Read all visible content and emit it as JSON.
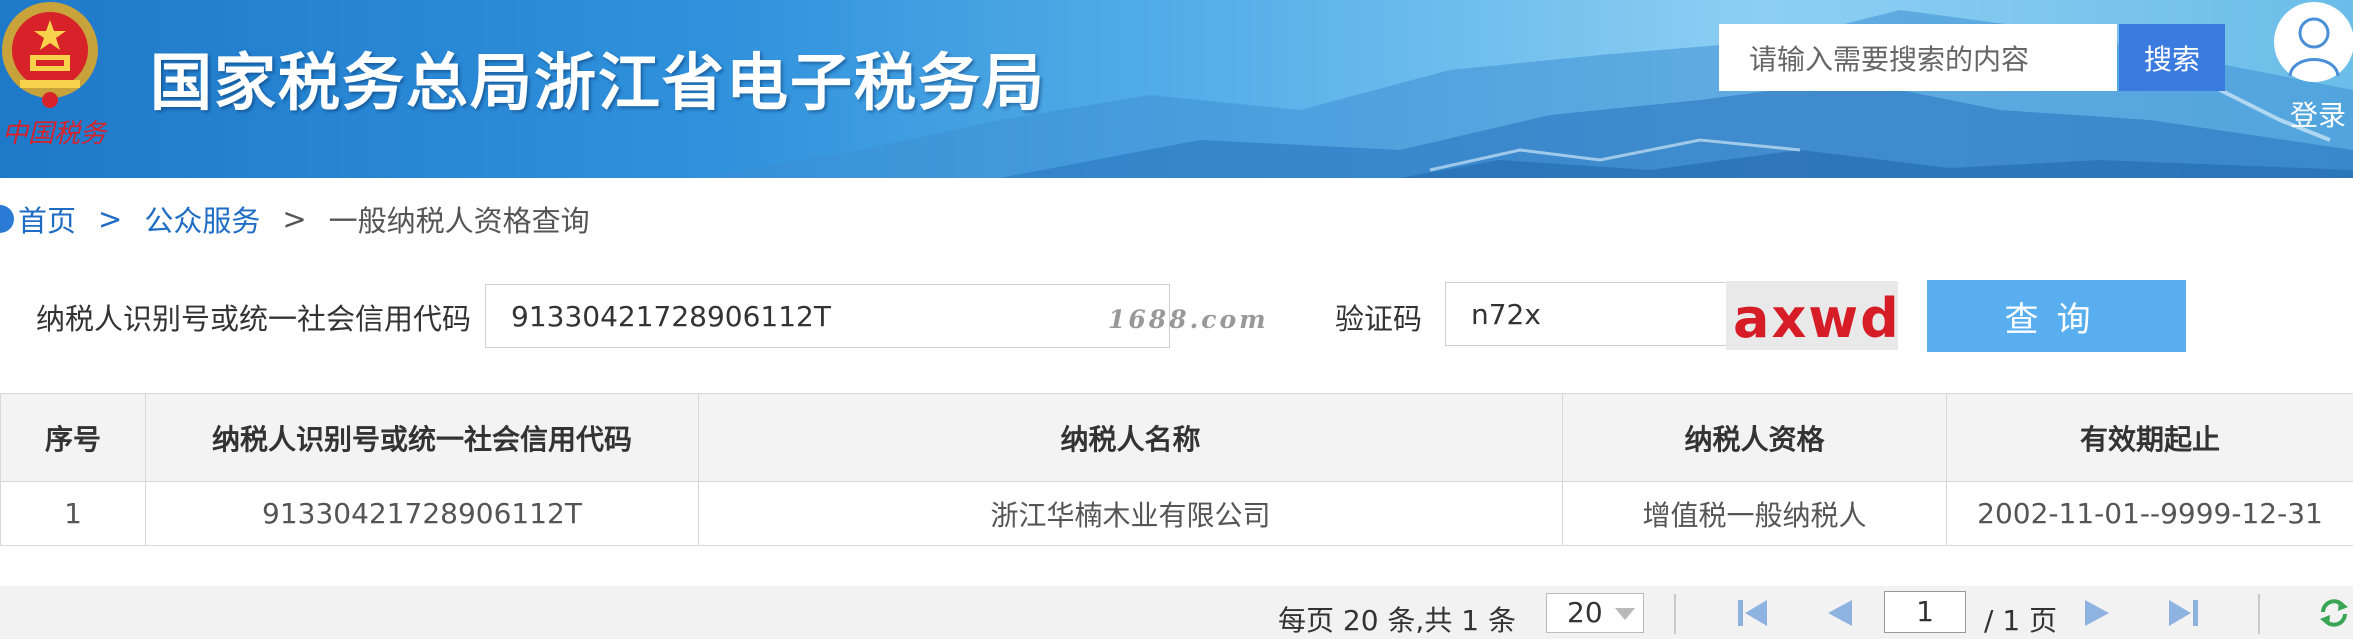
{
  "header": {
    "title": "国家税务总局浙江省电子税务局",
    "emblem_text": "中国税务",
    "search_placeholder": "请输入需要搜索的内容",
    "search_button": "搜索",
    "login_label": "登录"
  },
  "breadcrumb": {
    "home": "首页",
    "sep": ">",
    "section": "公众服务",
    "current": "一般纳税人资格查询"
  },
  "form": {
    "id_label": "纳税人识别号或统一社会信用代码",
    "id_value": "91330421728906112T",
    "watermark": "1688.com",
    "captcha_label": "验证码",
    "captcha_value": "n72x",
    "captcha_image_text": "axwd",
    "query_button": "查询"
  },
  "table": {
    "headers": [
      "序号",
      "纳税人识别号或统一社会信用代码",
      "纳税人名称",
      "纳税人资格",
      "有效期起止"
    ],
    "rows": [
      [
        "1",
        "91330421728906112T",
        "浙江华楠木业有限公司",
        "增值税一般纳税人",
        "2002-11-01--9999-12-31"
      ]
    ]
  },
  "pager": {
    "summary": "每页 20 条,共 1 条",
    "page_size": "20",
    "current_page": "1",
    "total_pages": "/ 1 页"
  },
  "colors": {
    "accent": "#3b7be0",
    "query_button": "#58aeef",
    "link": "#1e6cc4",
    "captcha": "#d61c26"
  },
  "icons": [
    "national-emblem-icon",
    "user-avatar-icon",
    "first-page-icon",
    "prev-page-icon",
    "next-page-icon",
    "last-page-icon",
    "refresh-icon"
  ]
}
